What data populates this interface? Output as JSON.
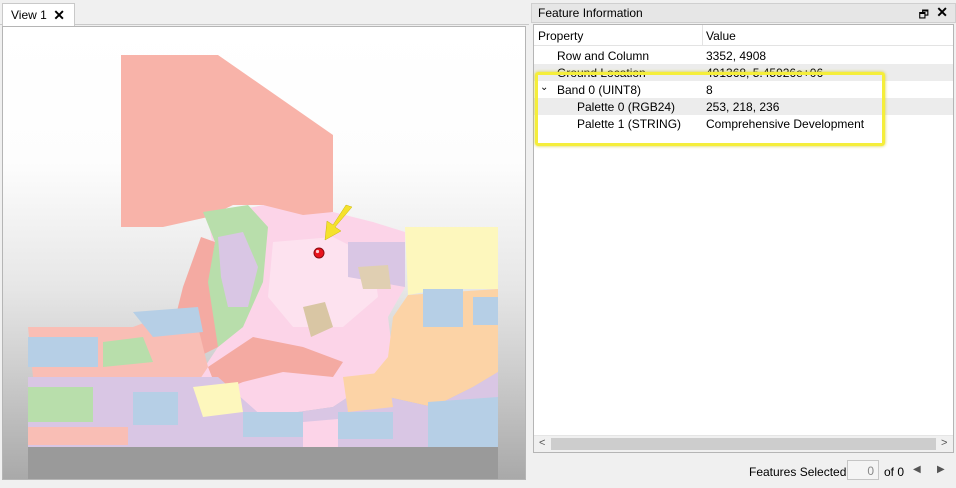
{
  "view": {
    "tab_label": "View 1",
    "tab_close_glyph": "✕",
    "map_image": "land-use-raster-map",
    "marker_color": "#e8131d",
    "arrow_color": "#f5e12c"
  },
  "feature_panel": {
    "title": "Feature Information",
    "restore_glyph": "🗗",
    "close_glyph": "✕",
    "columns": {
      "property": "Property",
      "value": "Value"
    },
    "rows": [
      {
        "property": "Row and Column",
        "value": "3352, 4908"
      },
      {
        "property": "Ground Location",
        "value": "491368, 5.45926e+06"
      },
      {
        "property": "Band 0 (UINT8)",
        "value": "8",
        "expanded": true
      },
      {
        "property": "Palette 0 (RGB24)",
        "value": "253, 218, 236"
      },
      {
        "property": "Palette 1 (STRING)",
        "value": "Comprehensive Development"
      }
    ],
    "expander_glyph": "⌄",
    "highlight_color": "#f5ee3a",
    "scroll_left_glyph": "<",
    "scroll_right_glyph": ">"
  },
  "status": {
    "features_selected_label": "Features Selected:",
    "count": "0",
    "of_text": "of 0",
    "prev_glyph": "◀",
    "next_glyph": "▶"
  }
}
